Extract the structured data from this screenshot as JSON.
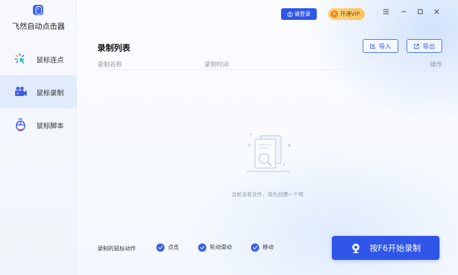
{
  "app": {
    "title": "飞然自动点击器"
  },
  "sidebar": {
    "items": [
      {
        "label": "鼠标连点",
        "icon": "mouse-click-icon",
        "active": false
      },
      {
        "label": "鼠标录制",
        "icon": "mouse-record-icon",
        "active": true
      },
      {
        "label": "鼠标脚本",
        "icon": "mouse-script-icon",
        "active": false
      }
    ]
  },
  "titlebar": {
    "login_label": "请登录",
    "vip_label": "开通VIP",
    "vip_badge": "V"
  },
  "list": {
    "title": "录制列表",
    "import_label": "导入",
    "export_label": "导出",
    "columns": [
      "录制名称",
      "录制时间",
      "操作"
    ],
    "empty_text": "当前没有文件，请先创建一个吧"
  },
  "footer": {
    "actions_label": "录制的鼠标动作",
    "options": [
      {
        "label": "点击",
        "checked": true
      },
      {
        "label": "轮动滑动",
        "checked": true
      },
      {
        "label": "移动",
        "checked": true
      }
    ],
    "record_label": "按F6开始录制"
  },
  "colors": {
    "primary": "#2f56e8",
    "vip": "#f9c35a",
    "sidebar_active": "#e1ebfb"
  }
}
